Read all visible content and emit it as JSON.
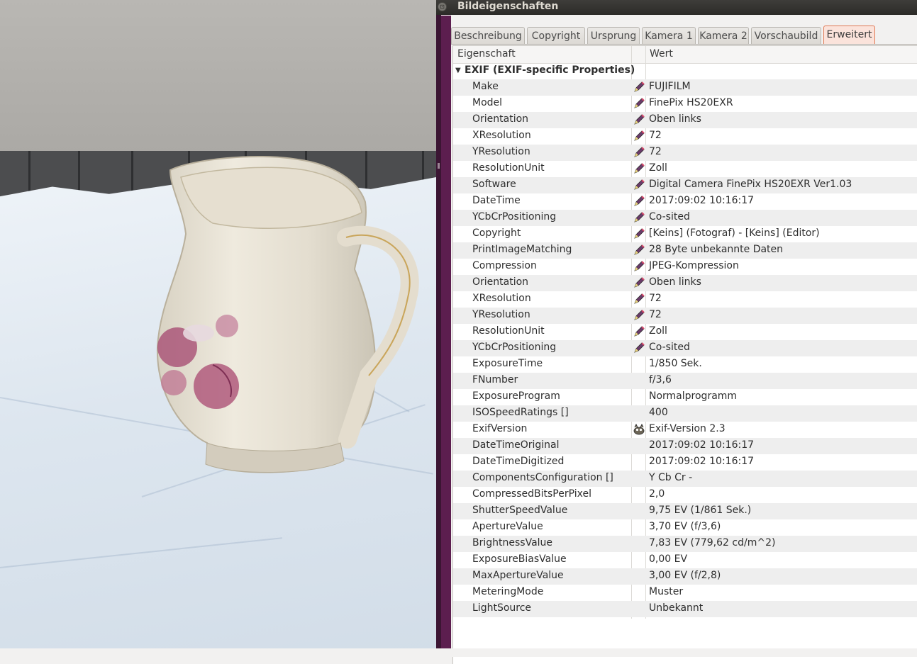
{
  "window": {
    "title": "Bildeigenschaften",
    "control_glyph": "⊡"
  },
  "tabs": [
    {
      "label": "Beschreibung",
      "active": false
    },
    {
      "label": "Copyright",
      "active": false
    },
    {
      "label": "Ursprung",
      "active": false
    },
    {
      "label": "Kamera 1",
      "active": false
    },
    {
      "label": "Kamera 2",
      "active": false
    },
    {
      "label": "Vorschaubild",
      "active": false
    },
    {
      "label": "Erweitert",
      "active": true
    }
  ],
  "table": {
    "columns": [
      "Eigenschaft",
      "Wert"
    ],
    "group": {
      "label": "EXIF (EXIF-specific Properties)",
      "expanded": true
    },
    "rows": [
      {
        "key": "Make",
        "value": "FUJIFILM",
        "icon": "edit-pen-icon"
      },
      {
        "key": "Model",
        "value": "FinePix HS20EXR",
        "icon": "edit-pen-icon"
      },
      {
        "key": "Orientation",
        "value": "Oben links",
        "icon": "edit-pen-icon"
      },
      {
        "key": "XResolution",
        "value": "72",
        "icon": "edit-pen-icon"
      },
      {
        "key": "YResolution",
        "value": "72",
        "icon": "edit-pen-icon"
      },
      {
        "key": "ResolutionUnit",
        "value": "Zoll",
        "icon": "edit-pen-icon"
      },
      {
        "key": "Software",
        "value": "Digital Camera FinePix HS20EXR Ver1.03",
        "icon": "edit-pen-icon"
      },
      {
        "key": "DateTime",
        "value": "2017:09:02 10:16:17",
        "icon": "edit-pen-icon"
      },
      {
        "key": "YCbCrPositioning",
        "value": "Co-sited",
        "icon": "edit-pen-icon"
      },
      {
        "key": "Copyright",
        "value": "[Keins] (Fotograf) - [Keins] (Editor)",
        "icon": "edit-pen-icon"
      },
      {
        "key": "PrintImageMatching",
        "value": "28 Byte unbekannte Daten",
        "icon": "edit-pen-icon"
      },
      {
        "key": "Compression",
        "value": "JPEG-Kompression",
        "icon": "edit-pen-icon"
      },
      {
        "key": "Orientation",
        "value": "Oben links",
        "icon": "edit-pen-icon"
      },
      {
        "key": "XResolution",
        "value": "72",
        "icon": "edit-pen-icon"
      },
      {
        "key": "YResolution",
        "value": "72",
        "icon": "edit-pen-icon"
      },
      {
        "key": "ResolutionUnit",
        "value": "Zoll",
        "icon": "edit-pen-icon"
      },
      {
        "key": "YCbCrPositioning",
        "value": "Co-sited",
        "icon": "edit-pen-icon"
      },
      {
        "key": "ExposureTime",
        "value": "1/850 Sek.",
        "icon": ""
      },
      {
        "key": "FNumber",
        "value": "f/3,6",
        "icon": ""
      },
      {
        "key": "ExposureProgram",
        "value": "Normalprogramm",
        "icon": ""
      },
      {
        "key": "ISOSpeedRatings []",
        "value": "400",
        "icon": ""
      },
      {
        "key": "ExifVersion",
        "value": "Exif-Version 2.3",
        "icon": "gimp-wilber-icon"
      },
      {
        "key": "DateTimeOriginal",
        "value": "2017:09:02 10:16:17",
        "icon": ""
      },
      {
        "key": "DateTimeDigitized",
        "value": "2017:09:02 10:16:17",
        "icon": ""
      },
      {
        "key": "ComponentsConfiguration []",
        "value": "Y Cb Cr -",
        "icon": ""
      },
      {
        "key": "CompressedBitsPerPixel",
        "value": "2,0",
        "icon": ""
      },
      {
        "key": "ShutterSpeedValue",
        "value": "9,75 EV (1/861 Sek.)",
        "icon": ""
      },
      {
        "key": "ApertureValue",
        "value": "3,70 EV (f/3,6)",
        "icon": ""
      },
      {
        "key": "BrightnessValue",
        "value": "7,83 EV (779,62 cd/m^2)",
        "icon": ""
      },
      {
        "key": "ExposureBiasValue",
        "value": "0,00 EV",
        "icon": ""
      },
      {
        "key": "MaxApertureValue",
        "value": "3,00 EV (f/2,8)",
        "icon": ""
      },
      {
        "key": "MeteringMode",
        "value": "Muster",
        "icon": ""
      },
      {
        "key": "LightSource",
        "value": "Unbekannt",
        "icon": ""
      }
    ]
  },
  "colors": {
    "active_tab_bg": "#fbe3db",
    "active_tab_border": "#e07a55",
    "side_accent": "#5c1e4f",
    "titlebar": "#2c2b28"
  }
}
